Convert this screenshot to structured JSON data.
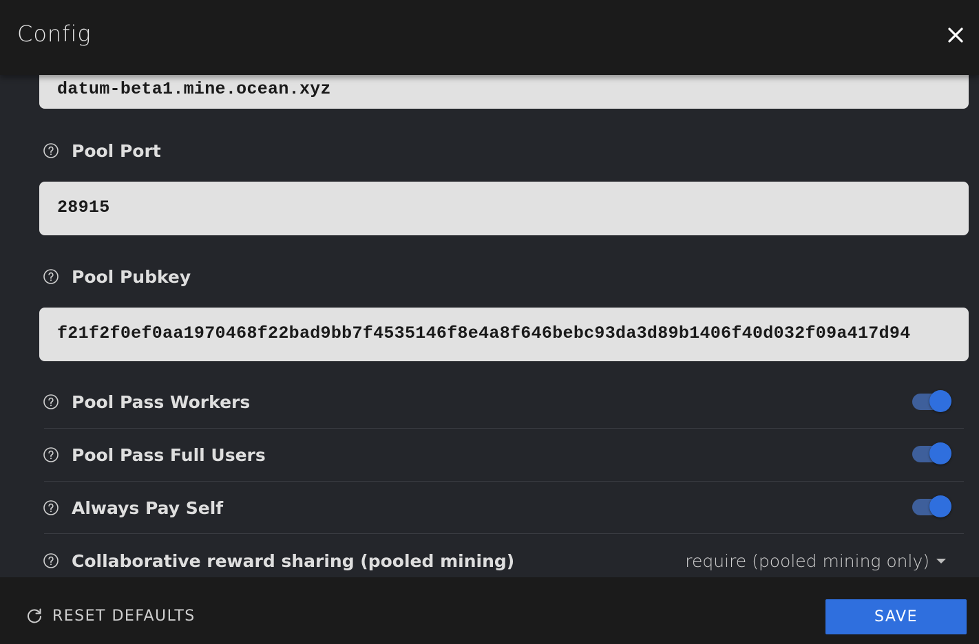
{
  "header": {
    "title": "Config",
    "close_icon": "close-icon"
  },
  "fields": {
    "pool_host": {
      "value": "datum-beta1.mine.ocean.xyz"
    },
    "pool_port": {
      "label": "Pool Port",
      "value": "28915"
    },
    "pool_pubkey": {
      "label": "Pool Pubkey",
      "value": "f21f2f0ef0aa1970468f22bad9bb7f4535146f8e4a8f646bebc93da3d89b1406f40d032f09a417d94"
    }
  },
  "toggles": [
    {
      "label": "Pool Pass Workers",
      "enabled": true
    },
    {
      "label": "Pool Pass Full Users",
      "enabled": true
    },
    {
      "label": "Always Pay Self",
      "enabled": true
    }
  ],
  "select_row": {
    "label": "Collaborative reward sharing (pooled mining)",
    "selected": "require (pooled mining only)"
  },
  "footer": {
    "reset_label": "RESET DEFAULTS",
    "save_label": "SAVE"
  },
  "colors": {
    "accent": "#2f6fde",
    "background": "#24262b",
    "bar_background": "#1b1b1b",
    "input_background": "#e1e1e1"
  }
}
